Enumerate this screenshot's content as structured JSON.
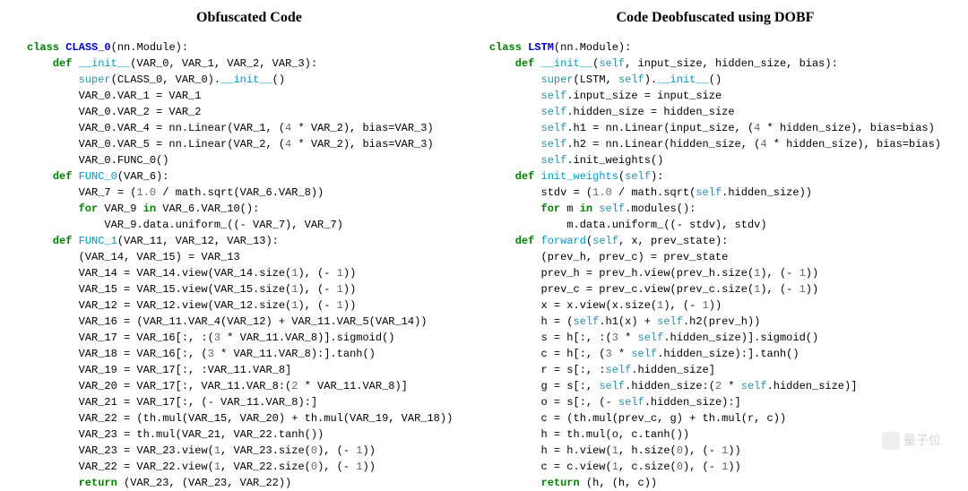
{
  "left": {
    "title": "Obfuscated Code",
    "lines": [
      [
        [
          "kw",
          "class"
        ],
        [
          "sp",
          " "
        ],
        [
          "cls",
          "CLASS_0"
        ],
        [
          "txt",
          "(nn.Module):"
        ]
      ],
      [
        [
          "txt",
          ""
        ]
      ],
      [
        [
          "txt",
          "    "
        ],
        [
          "kw",
          "def"
        ],
        [
          "sp",
          " "
        ],
        [
          "fn",
          "__init__"
        ],
        [
          "txt",
          "(VAR_0, VAR_1, VAR_2, VAR_3):"
        ]
      ],
      [
        [
          "txt",
          "        "
        ],
        [
          "sf",
          "super"
        ],
        [
          "txt",
          "(CLASS_0, VAR_0)."
        ],
        [
          "fn",
          "__init__"
        ],
        [
          "txt",
          "()"
        ]
      ],
      [
        [
          "txt",
          "        VAR_0.VAR_1 = VAR_1"
        ]
      ],
      [
        [
          "txt",
          "        VAR_0.VAR_2 = VAR_2"
        ]
      ],
      [
        [
          "txt",
          "        VAR_0.VAR_4 = nn.Linear(VAR_1, ("
        ],
        [
          "num",
          "4"
        ],
        [
          "txt",
          " * VAR_2), bias=VAR_3)"
        ]
      ],
      [
        [
          "txt",
          "        VAR_0.VAR_5 = nn.Linear(VAR_2, ("
        ],
        [
          "num",
          "4"
        ],
        [
          "txt",
          " * VAR_2), bias=VAR_3)"
        ]
      ],
      [
        [
          "txt",
          "        VAR_0.FUNC_0()"
        ]
      ],
      [
        [
          "txt",
          ""
        ]
      ],
      [
        [
          "txt",
          "    "
        ],
        [
          "kw",
          "def"
        ],
        [
          "sp",
          " "
        ],
        [
          "fn",
          "FUNC_0"
        ],
        [
          "txt",
          "(VAR_6):"
        ]
      ],
      [
        [
          "txt",
          "        VAR_7 = ("
        ],
        [
          "num",
          "1.0"
        ],
        [
          "txt",
          " / math.sqrt(VAR_6.VAR_8))"
        ]
      ],
      [
        [
          "txt",
          "        "
        ],
        [
          "kw",
          "for"
        ],
        [
          "txt",
          " VAR_9 "
        ],
        [
          "kw",
          "in"
        ],
        [
          "txt",
          " VAR_6.VAR_10():"
        ]
      ],
      [
        [
          "txt",
          "            VAR_9.data.uniform_((- VAR_7), VAR_7)"
        ]
      ],
      [
        [
          "txt",
          ""
        ]
      ],
      [
        [
          "txt",
          "    "
        ],
        [
          "kw",
          "def"
        ],
        [
          "sp",
          " "
        ],
        [
          "fn",
          "FUNC_1"
        ],
        [
          "txt",
          "(VAR_11, VAR_12, VAR_13):"
        ]
      ],
      [
        [
          "txt",
          "        (VAR_14, VAR_15) = VAR_13"
        ]
      ],
      [
        [
          "txt",
          "        VAR_14 = VAR_14.view(VAR_14.size("
        ],
        [
          "num",
          "1"
        ],
        [
          "txt",
          "), (- "
        ],
        [
          "num",
          "1"
        ],
        [
          "txt",
          "))"
        ]
      ],
      [
        [
          "txt",
          "        VAR_15 = VAR_15.view(VAR_15.size("
        ],
        [
          "num",
          "1"
        ],
        [
          "txt",
          "), (- "
        ],
        [
          "num",
          "1"
        ],
        [
          "txt",
          "))"
        ]
      ],
      [
        [
          "txt",
          "        VAR_12 = VAR_12.view(VAR_12.size("
        ],
        [
          "num",
          "1"
        ],
        [
          "txt",
          "), (- "
        ],
        [
          "num",
          "1"
        ],
        [
          "txt",
          "))"
        ]
      ],
      [
        [
          "txt",
          "        VAR_16 = (VAR_11.VAR_4(VAR_12) + VAR_11.VAR_5(VAR_14))"
        ]
      ],
      [
        [
          "txt",
          "        VAR_17 = VAR_16[:, :("
        ],
        [
          "num",
          "3"
        ],
        [
          "txt",
          " * VAR_11.VAR_8)].sigmoid()"
        ]
      ],
      [
        [
          "txt",
          "        VAR_18 = VAR_16[:, ("
        ],
        [
          "num",
          "3"
        ],
        [
          "txt",
          " * VAR_11.VAR_8):].tanh()"
        ]
      ],
      [
        [
          "txt",
          "        VAR_19 = VAR_17[:, :VAR_11.VAR_8]"
        ]
      ],
      [
        [
          "txt",
          "        VAR_20 = VAR_17[:, VAR_11.VAR_8:("
        ],
        [
          "num",
          "2"
        ],
        [
          "txt",
          " * VAR_11.VAR_8)]"
        ]
      ],
      [
        [
          "txt",
          "        VAR_21 = VAR_17[:, (- VAR_11.VAR_8):]"
        ]
      ],
      [
        [
          "txt",
          "        VAR_22 = (th.mul(VAR_15, VAR_20) + th.mul(VAR_19, VAR_18))"
        ]
      ],
      [
        [
          "txt",
          "        VAR_23 = th.mul(VAR_21, VAR_22.tanh())"
        ]
      ],
      [
        [
          "txt",
          "        VAR_23 = VAR_23.view("
        ],
        [
          "num",
          "1"
        ],
        [
          "txt",
          ", VAR_23.size("
        ],
        [
          "num",
          "0"
        ],
        [
          "txt",
          "), (- "
        ],
        [
          "num",
          "1"
        ],
        [
          "txt",
          "))"
        ]
      ],
      [
        [
          "txt",
          "        VAR_22 = VAR_22.view("
        ],
        [
          "num",
          "1"
        ],
        [
          "txt",
          ", VAR_22.size("
        ],
        [
          "num",
          "0"
        ],
        [
          "txt",
          "), (- "
        ],
        [
          "num",
          "1"
        ],
        [
          "txt",
          "))"
        ]
      ],
      [
        [
          "txt",
          "        "
        ],
        [
          "kw",
          "return"
        ],
        [
          "txt",
          " (VAR_23, (VAR_23, VAR_22))"
        ]
      ]
    ]
  },
  "right": {
    "title": "Code Deobfuscated using DOBF",
    "lines": [
      [
        [
          "kw",
          "class"
        ],
        [
          "sp",
          " "
        ],
        [
          "cls",
          "LSTM"
        ],
        [
          "txt",
          "(nn.Module):"
        ]
      ],
      [
        [
          "txt",
          ""
        ]
      ],
      [
        [
          "txt",
          "    "
        ],
        [
          "kw",
          "def"
        ],
        [
          "sp",
          " "
        ],
        [
          "fn",
          "__init__"
        ],
        [
          "txt",
          "("
        ],
        [
          "sf",
          "self"
        ],
        [
          "txt",
          ", input_size, hidden_size, bias):"
        ]
      ],
      [
        [
          "txt",
          "        "
        ],
        [
          "sf",
          "super"
        ],
        [
          "txt",
          "(LSTM, "
        ],
        [
          "sf",
          "self"
        ],
        [
          "txt",
          ")."
        ],
        [
          "fn",
          "__init__"
        ],
        [
          "txt",
          "()"
        ]
      ],
      [
        [
          "txt",
          "        "
        ],
        [
          "sf",
          "self"
        ],
        [
          "txt",
          ".input_size = input_size"
        ]
      ],
      [
        [
          "txt",
          "        "
        ],
        [
          "sf",
          "self"
        ],
        [
          "txt",
          ".hidden_size = hidden_size"
        ]
      ],
      [
        [
          "txt",
          "        "
        ],
        [
          "sf",
          "self"
        ],
        [
          "txt",
          ".h1 = nn.Linear(input_size, ("
        ],
        [
          "num",
          "4"
        ],
        [
          "txt",
          " * hidden_size), bias=bias)"
        ]
      ],
      [
        [
          "txt",
          "        "
        ],
        [
          "sf",
          "self"
        ],
        [
          "txt",
          ".h2 = nn.Linear(hidden_size, ("
        ],
        [
          "num",
          "4"
        ],
        [
          "txt",
          " * hidden_size), bias=bias)"
        ]
      ],
      [
        [
          "txt",
          "        "
        ],
        [
          "sf",
          "self"
        ],
        [
          "txt",
          ".init_weights()"
        ]
      ],
      [
        [
          "txt",
          ""
        ]
      ],
      [
        [
          "txt",
          "    "
        ],
        [
          "kw",
          "def"
        ],
        [
          "sp",
          " "
        ],
        [
          "fn",
          "init_weights"
        ],
        [
          "txt",
          "("
        ],
        [
          "sf",
          "self"
        ],
        [
          "txt",
          "):"
        ]
      ],
      [
        [
          "txt",
          "        stdv = ("
        ],
        [
          "num",
          "1.0"
        ],
        [
          "txt",
          " / math.sqrt("
        ],
        [
          "sf",
          "self"
        ],
        [
          "txt",
          ".hidden_size))"
        ]
      ],
      [
        [
          "txt",
          "        "
        ],
        [
          "kw",
          "for"
        ],
        [
          "txt",
          " m "
        ],
        [
          "kw",
          "in"
        ],
        [
          "txt",
          " "
        ],
        [
          "sf",
          "self"
        ],
        [
          "txt",
          ".modules():"
        ]
      ],
      [
        [
          "txt",
          "            m.data.uniform_((- stdv), stdv)"
        ]
      ],
      [
        [
          "txt",
          ""
        ]
      ],
      [
        [
          "txt",
          "    "
        ],
        [
          "kw",
          "def"
        ],
        [
          "sp",
          " "
        ],
        [
          "fn",
          "forward"
        ],
        [
          "txt",
          "("
        ],
        [
          "sf",
          "self"
        ],
        [
          "txt",
          ", x, prev_state):"
        ]
      ],
      [
        [
          "txt",
          "        (prev_h, prev_c) = prev_state"
        ]
      ],
      [
        [
          "txt",
          "        prev_h = prev_h.view(prev_h.size("
        ],
        [
          "num",
          "1"
        ],
        [
          "txt",
          "), (- "
        ],
        [
          "num",
          "1"
        ],
        [
          "txt",
          "))"
        ]
      ],
      [
        [
          "txt",
          "        prev_c = prev_c.view(prev_c.size("
        ],
        [
          "num",
          "1"
        ],
        [
          "txt",
          "), (- "
        ],
        [
          "num",
          "1"
        ],
        [
          "txt",
          "))"
        ]
      ],
      [
        [
          "txt",
          "        x = x.view(x.size("
        ],
        [
          "num",
          "1"
        ],
        [
          "txt",
          "), (- "
        ],
        [
          "num",
          "1"
        ],
        [
          "txt",
          "))"
        ]
      ],
      [
        [
          "txt",
          "        h = ("
        ],
        [
          "sf",
          "self"
        ],
        [
          "txt",
          ".h1(x) + "
        ],
        [
          "sf",
          "self"
        ],
        [
          "txt",
          ".h2(prev_h))"
        ]
      ],
      [
        [
          "txt",
          "        s = h[:, :("
        ],
        [
          "num",
          "3"
        ],
        [
          "txt",
          " * "
        ],
        [
          "sf",
          "self"
        ],
        [
          "txt",
          ".hidden_size)].sigmoid()"
        ]
      ],
      [
        [
          "txt",
          "        c = h[:, ("
        ],
        [
          "num",
          "3"
        ],
        [
          "txt",
          " * "
        ],
        [
          "sf",
          "self"
        ],
        [
          "txt",
          ".hidden_size):].tanh()"
        ]
      ],
      [
        [
          "txt",
          "        r = s[:, :"
        ],
        [
          "sf",
          "self"
        ],
        [
          "txt",
          ".hidden_size]"
        ]
      ],
      [
        [
          "txt",
          "        g = s[:, "
        ],
        [
          "sf",
          "self"
        ],
        [
          "txt",
          ".hidden_size:("
        ],
        [
          "num",
          "2"
        ],
        [
          "txt",
          " * "
        ],
        [
          "sf",
          "self"
        ],
        [
          "txt",
          ".hidden_size)]"
        ]
      ],
      [
        [
          "txt",
          "        o = s[:, (- "
        ],
        [
          "sf",
          "self"
        ],
        [
          "txt",
          ".hidden_size):]"
        ]
      ],
      [
        [
          "txt",
          "        c = (th.mul(prev_c, g) + th.mul(r, c))"
        ]
      ],
      [
        [
          "txt",
          "        h = th.mul(o, c.tanh())"
        ]
      ],
      [
        [
          "txt",
          "        h = h.view("
        ],
        [
          "num",
          "1"
        ],
        [
          "txt",
          ", h.size("
        ],
        [
          "num",
          "0"
        ],
        [
          "txt",
          "), (- "
        ],
        [
          "num",
          "1"
        ],
        [
          "txt",
          "))"
        ]
      ],
      [
        [
          "txt",
          "        c = c.view("
        ],
        [
          "num",
          "1"
        ],
        [
          "txt",
          ", c.size("
        ],
        [
          "num",
          "0"
        ],
        [
          "txt",
          "), (- "
        ],
        [
          "num",
          "1"
        ],
        [
          "txt",
          "))"
        ]
      ],
      [
        [
          "txt",
          "        "
        ],
        [
          "kw",
          "return"
        ],
        [
          "txt",
          " (h, (h, c))"
        ]
      ]
    ]
  },
  "watermark": "量子位"
}
